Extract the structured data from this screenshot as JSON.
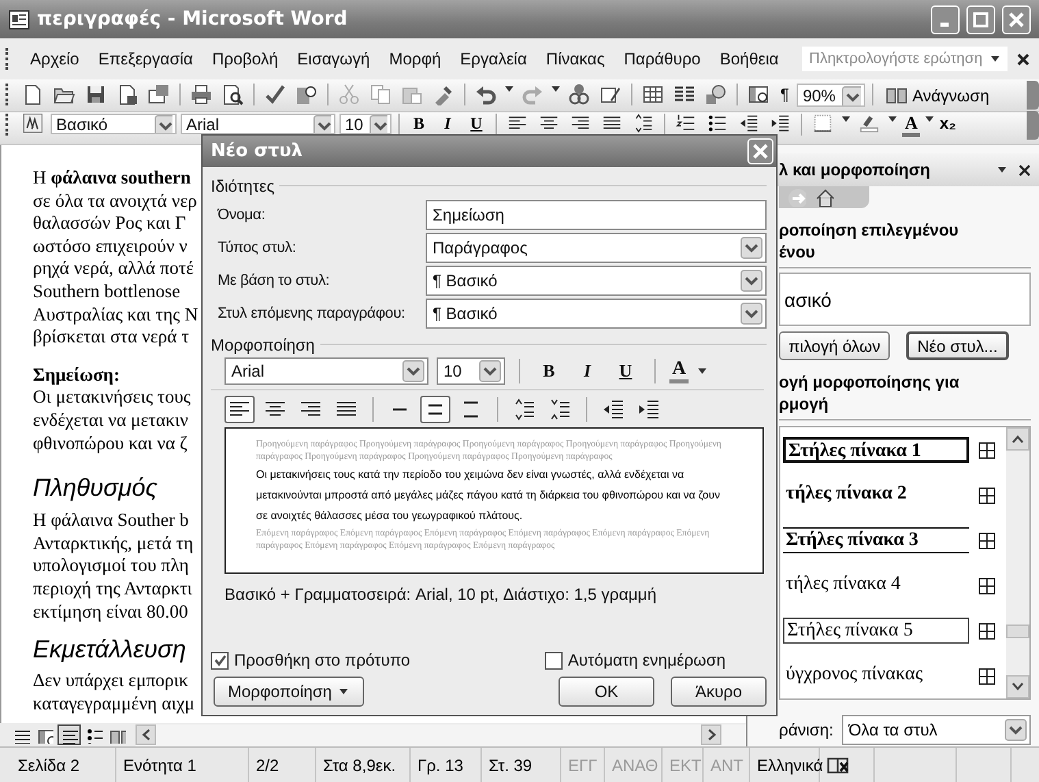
{
  "window": {
    "title": "περιγραφές - Microsoft Word"
  },
  "menu": [
    "Αρχείο",
    "Επεξεργασία",
    "Προβολή",
    "Εισαγωγή",
    "Μορφή",
    "Εργαλεία",
    "Πίνακας",
    "Παράθυρο",
    "Βοήθεια"
  ],
  "help_box": {
    "placeholder": "Πληκτρολογήστε ερώτηση"
  },
  "standard_toolbar": {
    "show_marks": "¶",
    "zoom": "90%",
    "reading_button": "Ανάγνωση"
  },
  "formatting_toolbar": {
    "style": "Βασικό",
    "font": "Arial",
    "size": "10",
    "bold": "B",
    "italic": "I",
    "underline": "U",
    "font_color": "A",
    "subscript": "x₂"
  },
  "document": {
    "blocks": [
      {
        "kind": "para",
        "lines": [
          "Η **φάλαινα southern**",
          "σε όλα τα ανοιχτά νερ",
          "θαλασσών Ρος και Γ",
          "ωστόσο επιχειρούν ν",
          "ρηχά νερά, αλλά ποτέ",
          "Southern bottlenose",
          "Αυστραλίας και της Ν",
          "βρίσκεται στα νερά τ"
        ]
      },
      {
        "kind": "para",
        "lines": [
          "**Σημείωση:**",
          "Οι μετακινήσεις τους",
          "ενδέχεται να μετακιν",
          "φθινοπώρου και να ζ"
        ]
      },
      {
        "kind": "heading",
        "lines": [
          "Πληθυσμός"
        ]
      },
      {
        "kind": "para",
        "lines": [
          "Η φάλαινα Souther b",
          "Ανταρκτικής, μετά τη",
          "υπολογισμοί του πλη",
          "περιοχή της Ανταρκτι",
          "εκτίμηση είναι 80.00"
        ]
      },
      {
        "kind": "heading",
        "lines": [
          "Εκμετάλλευση"
        ]
      },
      {
        "kind": "para",
        "lines": [
          "Δεν υπάρχει εμπορικ",
          "καταγεγραμμένη αιχμ"
        ]
      }
    ]
  },
  "task_pane": {
    "title": "λ και μορφοποίηση",
    "selection_heading": "ροποίηση επιλεγμένου\nένου",
    "current_style": "ασικό",
    "buttons": [
      {
        "label": "πιλογή όλων",
        "default": false
      },
      {
        "label": "Νέο στυλ...",
        "default": true
      }
    ],
    "apply_heading": "ογή μορφοποίησης για\nρμογή",
    "styles": [
      {
        "label": "Στήλες πίνακα 1",
        "boxed": true,
        "ruled": false,
        "bold": true
      },
      {
        "label": "τήλες πίνακα 2",
        "boxed": false,
        "ruled": false,
        "bold": true
      },
      {
        "label": "Στήλες πίνακα 3",
        "boxed": false,
        "ruled": true,
        "bold": true
      },
      {
        "label": "τήλες πίνακα 4",
        "boxed": false,
        "ruled": false,
        "bold": false
      },
      {
        "label": "Στήλες πίνακα 5",
        "boxed": true,
        "ruled": false,
        "bold": false
      },
      {
        "label": "ύγχρονος πίνακας",
        "boxed": false,
        "ruled": false,
        "bold": false
      }
    ],
    "show_label": "ράνιση:",
    "show_value": "Όλα τα στυλ"
  },
  "dialog": {
    "title": "Νέο στυλ",
    "properties_label": "Ιδιότητες",
    "fields": [
      {
        "label": "Όνομα:",
        "kind": "text",
        "value": "Σημείωση"
      },
      {
        "label": "Τύπος στυλ:",
        "kind": "select",
        "value": "Παράγραφος"
      },
      {
        "label": "Με βάση το στυλ:",
        "kind": "select",
        "value": "¶ Βασικό"
      },
      {
        "label": "Στυλ επόμενης παραγράφου:",
        "kind": "select",
        "value": "¶ Βασικό"
      }
    ],
    "formatting_label": "Μορφοποίηση",
    "font": "Arial",
    "size": "10",
    "bold": "B",
    "italic": "I",
    "underline": "U",
    "font_color": "A",
    "alignment": [
      {
        "selected": true
      },
      {
        "selected": false
      },
      {
        "selected": false
      },
      {
        "selected": false
      }
    ],
    "line_spacing": [
      {
        "selected": false
      },
      {
        "selected": true
      },
      {
        "selected": false
      }
    ],
    "preview": {
      "previous": "Προηγούμενη παράγραφος Προηγούμενη παράγραφος Προηγούμενη παράγραφος Προηγούμενη παράγραφος Προηγούμενη παράγραφος Προηγούμενη παράγραφος Προηγούμενη παράγραφος Προηγούμενη παράγραφος",
      "sample": "Οι μετακινήσεις τους κατά την περίοδο του χειμώνα δεν είναι γνωστές, αλλά ενδέχεται να μετακινούνται μπροστά από μεγάλες μάζες πάγου κατά τη διάρκεια του φθινοπώρου και να ζουν σε ανοιχτές θάλασσες μέσα του γεωγραφικού πλάτους.",
      "next": "Επόμενη παράγραφος Επόμενη παράγραφος Επόμενη παράγραφος Επόμενη παράγραφος Επόμενη παράγραφος Επόμενη παράγραφος Επόμενη παράγραφος Επόμενη παράγραφος Επόμενη παράγραφος"
    },
    "description": "Βασικό + Γραμματοσειρά: Arial, 10 pt, Διάστιχο:  1,5 γραμμή",
    "checkboxes": [
      {
        "label": "Προσθήκη στο πρότυπο",
        "checked": true
      },
      {
        "label": "Αυτόματη ενημέρωση",
        "checked": false
      }
    ],
    "buttons": [
      {
        "label": "Μορφοποίηση",
        "kind": "menu"
      },
      {
        "label": "OK",
        "kind": "default"
      },
      {
        "label": "Άκυρο",
        "kind": "plain"
      }
    ]
  },
  "status_bar": {
    "fields": [
      "Σελίδα 2",
      "Ενότητα 1",
      "2/2",
      "Στα 8,9εκ.",
      "Γρ. 13",
      "Στ. 39"
    ],
    "modes": [
      {
        "label": "ΕΓΓ",
        "disabled": true
      },
      {
        "label": "ΑΝΑΘ",
        "disabled": true
      },
      {
        "label": "ΕΚΤ",
        "disabled": true
      },
      {
        "label": "ΑΝΤ",
        "disabled": true
      }
    ],
    "language": "Ελληνικά"
  }
}
